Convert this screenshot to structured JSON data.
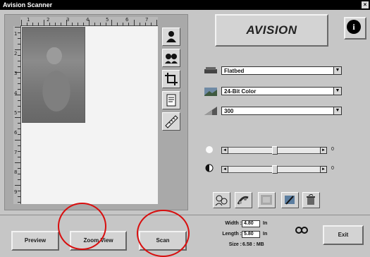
{
  "window": {
    "title": "Avision Scanner",
    "close_glyph": "×"
  },
  "header": {
    "brand": "AVISION",
    "info_glyph": "i"
  },
  "controls": {
    "scan_mode": "Flatbed",
    "image_type": "24-Bit Color",
    "resolution": "300",
    "brightness_value": "0",
    "contrast_value": "0",
    "dropdown_arrow": "▼",
    "slider_left": "◄",
    "slider_right": "►"
  },
  "levels": {
    "brightness_fraction": 0.5,
    "contrast_fraction": 0.5
  },
  "measurements": {
    "width_label": "Width :",
    "width_value": "4.80",
    "width_unit": "In",
    "length_label": "Length :",
    "length_value": "5.80",
    "length_unit": "In",
    "size_label": "Size :",
    "size_value": "6.58 : MB"
  },
  "footer": {
    "preview_label": "Preview",
    "zoom_label": "Zoom View",
    "scan_label": "Scan",
    "exit_label": "Exit"
  },
  "ruler": {
    "top_numbers": [
      "1",
      "2",
      "3",
      "4",
      "5",
      "6",
      "7"
    ],
    "left_numbers": [
      "1",
      "2",
      "3",
      "4",
      "5",
      "6",
      "7",
      "8",
      "9"
    ]
  },
  "icons": {
    "toolbar": [
      "person-silhouette-icon",
      "mirror-face-icon",
      "crop-icon",
      "document-icon",
      "ruler-icon"
    ],
    "right_panel": [
      "scanner-icon",
      "image-type-icon",
      "resolution-icon",
      "brightness-icon",
      "contrast-icon",
      "face-adjust-icon",
      "color-balance-icon",
      "halftone-icon",
      "eyedropper-icon",
      "trash-icon",
      "link-icon"
    ]
  },
  "colors": {
    "highlight_circle": "#d80e0e"
  }
}
